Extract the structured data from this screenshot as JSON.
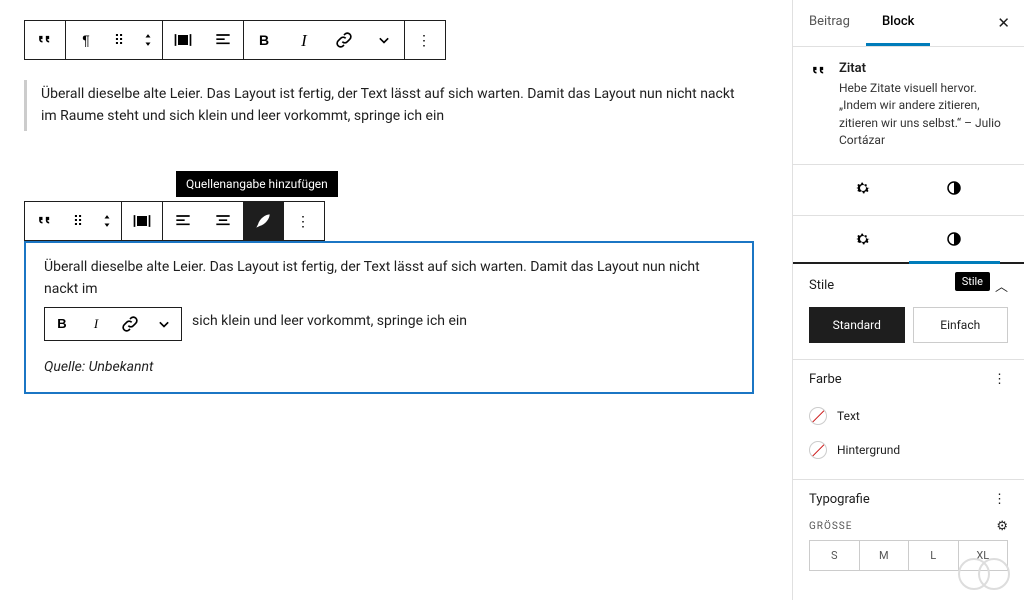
{
  "block1": {
    "text": "Überall dieselbe alte Leier. Das Layout ist fertig, der Text lässt auf sich warten. Damit das Layout nun nicht nackt im Raume steht und sich klein und leer vorkommt, springe ich ein"
  },
  "block2": {
    "text_before": "Überall dieselbe alte Leier. Das Layout ist fertig, der Text lässt auf sich warten. Damit das Layout nun nicht nackt im",
    "text_after": "sich klein und leer vorkommt, springe ich ein",
    "citation": "Quelle: Unbekannt",
    "tooltip": "Quellenangabe hinzufügen"
  },
  "sidebar": {
    "tabs": {
      "post": "Beitrag",
      "block": "Block"
    },
    "block_type": {
      "name": "Zitat",
      "description": "Hebe Zitate visuell hervor. „Indem wir andere zitieren, zitieren wir uns selbst.“ – Julio Cortázar"
    },
    "styles": {
      "label": "Stile",
      "tooltip": "Stile",
      "options": {
        "standard": "Standard",
        "simple": "Einfach"
      }
    },
    "color": {
      "label": "Farbe",
      "text": "Text",
      "background": "Hintergrund"
    },
    "typography": {
      "label": "Typografie",
      "size_label": "GRÖSSE",
      "sizes": [
        "S",
        "M",
        "L",
        "XL"
      ]
    }
  }
}
